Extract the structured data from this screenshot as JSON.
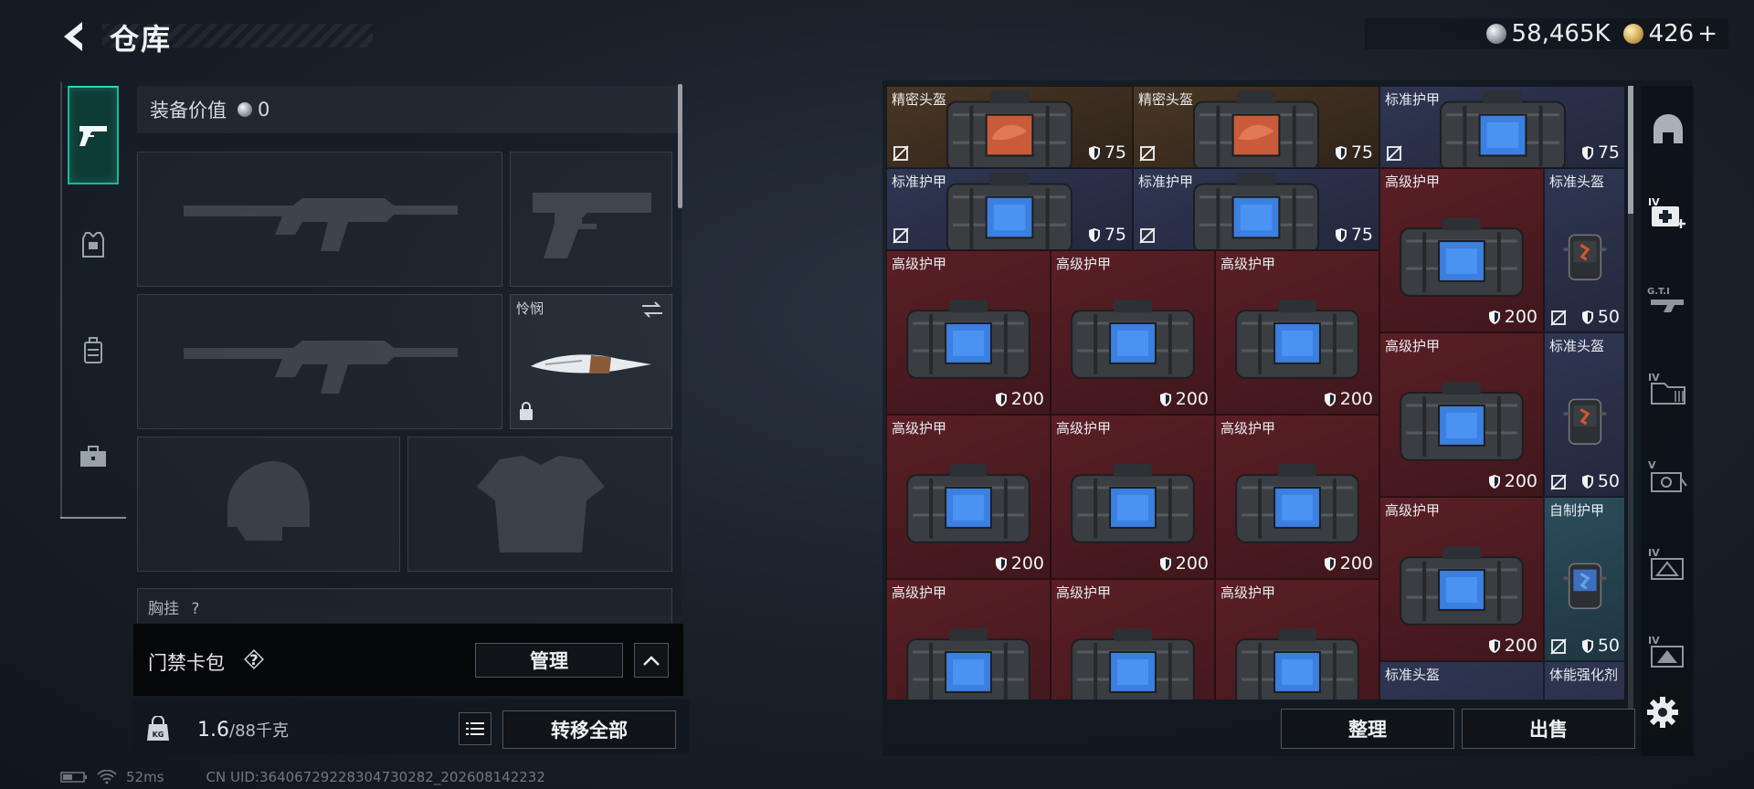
{
  "header": {
    "title": "仓库",
    "back_icon": "back-arrow-icon"
  },
  "currency": {
    "silver_amount": "58,465K",
    "gold_amount": "426",
    "gold_plus": "+",
    "silver_color": "#a8b0b7",
    "gold_color": "#c9a24a"
  },
  "categories": [
    {
      "icon": "pistol-icon",
      "active": true
    },
    {
      "icon": "armor-vest-icon",
      "active": false
    },
    {
      "icon": "backpack-icon",
      "active": false
    },
    {
      "icon": "toolbox-icon",
      "active": false
    }
  ],
  "equipment": {
    "value_label": "装备价值",
    "value": "0",
    "melee_slot_name": "怜悯",
    "partial_label": "胸挂",
    "partial_help": "?",
    "keycard_label": "门禁卡包",
    "keycard_help": "?",
    "manage_label": "管理",
    "weight_current": "1.6",
    "weight_max": "/88千克",
    "transfer_all_label": "转移全部"
  },
  "stash": {
    "tidy_label": "整理",
    "sell_label": "出售",
    "items": [
      {
        "name": "精密头盔",
        "durability": "75",
        "tint": "brown",
        "kind": "helmet-case"
      },
      {
        "name": "精密头盔",
        "durability": "75",
        "tint": "brown",
        "kind": "helmet-case"
      },
      {
        "name": "标准护甲",
        "durability": "75",
        "tint": "navy",
        "kind": "vest-case"
      },
      {
        "name": "标准护甲",
        "durability": "75",
        "tint": "navy",
        "kind": "vest-case"
      },
      {
        "name": "标准护甲",
        "durability": "75",
        "tint": "navy",
        "kind": "vest-case"
      },
      {
        "name": "高级护甲",
        "durability": "200",
        "tint": "red",
        "kind": "armor-bag"
      },
      {
        "name": "标准头盔",
        "durability": "50",
        "tint": "navy",
        "kind": "helmet"
      },
      {
        "name": "高级护甲",
        "durability": "200",
        "tint": "red",
        "kind": "armor-bag"
      },
      {
        "name": "高级护甲",
        "durability": "200",
        "tint": "red",
        "kind": "armor-bag"
      },
      {
        "name": "高级护甲",
        "durability": "200",
        "tint": "red",
        "kind": "armor-bag"
      },
      {
        "name": "高级护甲",
        "durability": "200",
        "tint": "red",
        "kind": "armor-bag"
      },
      {
        "name": "标准头盔",
        "durability": "50",
        "tint": "navy",
        "kind": "helmet"
      },
      {
        "name": "高级护甲",
        "durability": "200",
        "tint": "red",
        "kind": "armor-bag"
      },
      {
        "name": "高级护甲",
        "durability": "200",
        "tint": "red",
        "kind": "armor-bag"
      },
      {
        "name": "高级护甲",
        "durability": "200",
        "tint": "red",
        "kind": "armor-bag"
      },
      {
        "name": "高级护甲",
        "durability": "200",
        "tint": "red",
        "kind": "armor-bag"
      },
      {
        "name": "自制护甲",
        "durability": "50",
        "tint": "teal",
        "kind": "homemade-vest"
      },
      {
        "name": "高级护甲",
        "durability": "",
        "tint": "red",
        "kind": "armor-bag"
      },
      {
        "name": "高级护甲",
        "durability": "",
        "tint": "red",
        "kind": "armor-bag"
      },
      {
        "name": "高级护甲",
        "durability": "",
        "tint": "red",
        "kind": "armor-bag"
      },
      {
        "name": "标准头盔",
        "durability": "",
        "tint": "navy",
        "kind": "helmet"
      },
      {
        "name": "体能强化剂",
        "durability": "",
        "tint": "navy",
        "kind": "injector"
      }
    ]
  },
  "side_rail": [
    {
      "icon": "helmet-silhouette-icon"
    },
    {
      "icon": "medkit-tier-icon",
      "tier": "IV"
    },
    {
      "icon": "gt-tier-icon",
      "tier": "G.T.I"
    },
    {
      "icon": "folder-tier-icon",
      "tier": "IV"
    },
    {
      "icon": "camera-tier-icon",
      "tier": "V"
    },
    {
      "icon": "triangle-tier-icon",
      "tier": "IV"
    },
    {
      "icon": "triangle-tier-icon-2",
      "tier": "IV"
    },
    {
      "icon": "settings-gear-icon"
    }
  ],
  "status": {
    "ping": "52ms",
    "uid": "CN UID:3640672922830473028​2_202608142232"
  }
}
